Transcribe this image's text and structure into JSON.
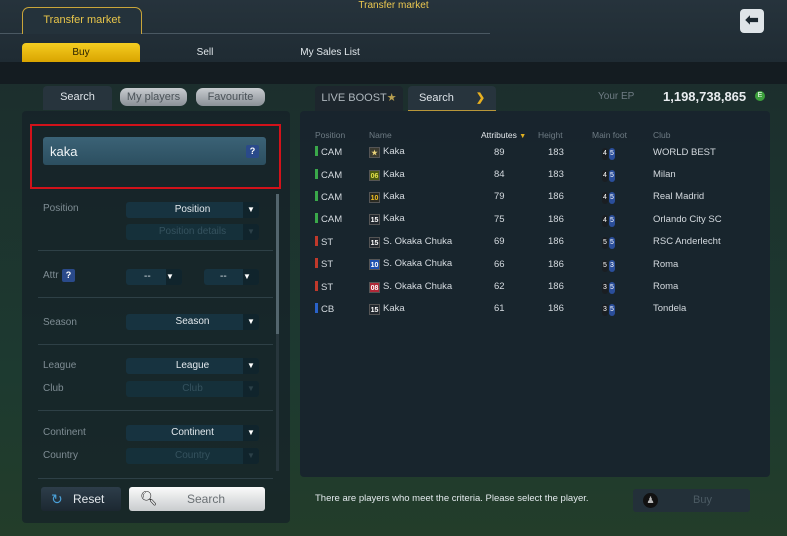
{
  "window_title": "Transfer market",
  "main_tab": "Transfer market",
  "subtabs": [
    "Buy",
    "Sell",
    "My Sales List"
  ],
  "left_tabs": [
    "Search",
    "My players",
    "Favourite"
  ],
  "search": {
    "value": "kaka",
    "help": "?"
  },
  "filters": {
    "position_label": "Position",
    "position": "Position",
    "position_details": "Position details",
    "attr_label": "Attr",
    "attr_help": "?",
    "attr_min": "--",
    "attr_max": "--",
    "season_label": "Season",
    "season": "Season",
    "league_label": "League",
    "league": "League",
    "club_label": "Club",
    "club": "Club",
    "continent_label": "Continent",
    "continent": "Continent",
    "country_label": "Country",
    "country": "Country"
  },
  "reset_label": "Reset",
  "search_label": "Search",
  "right_tabs": [
    "LIVE BOOST",
    "Search"
  ],
  "ep": {
    "label": "Your EP",
    "value": "1,198,738,865",
    "icon_letter": "E"
  },
  "table": {
    "headers": [
      "Position",
      "Name",
      "Attributes",
      "Height",
      "Main foot",
      "Club"
    ],
    "rows": [
      {
        "pos": "CAM",
        "pos_color": "#3aa84a",
        "season": "★",
        "season_bg": "#3a3a30",
        "season_fg": "#e8d27a",
        "name": "Kaka",
        "attr": "89",
        "height": "183",
        "foot": [
          "4",
          "5"
        ],
        "club": "WORLD BEST"
      },
      {
        "pos": "CAM",
        "pos_color": "#3aa84a",
        "season": "06",
        "season_bg": "#4d5a14",
        "season_fg": "#e6e24a",
        "name": "Kaka",
        "attr": "84",
        "height": "183",
        "foot": [
          "4",
          "5"
        ],
        "club": "Milan"
      },
      {
        "pos": "CAM",
        "pos_color": "#3aa84a",
        "season": "10",
        "season_bg": "#2a2a22",
        "season_fg": "#f0c020",
        "name": "Kaka",
        "attr": "79",
        "height": "186",
        "foot": [
          "4",
          "5"
        ],
        "club": "Real Madrid"
      },
      {
        "pos": "CAM",
        "pos_color": "#3aa84a",
        "season": "15",
        "season_bg": "#22282e",
        "season_fg": "#ffffff",
        "name": "Kaka",
        "attr": "75",
        "height": "186",
        "foot": [
          "4",
          "5"
        ],
        "club": "Orlando City SC"
      },
      {
        "pos": "ST",
        "pos_color": "#c0392b",
        "season": "15",
        "season_bg": "#22282e",
        "season_fg": "#ffffff",
        "name": "S. Okaka Chuka",
        "attr": "69",
        "height": "186",
        "foot": [
          "5",
          "5"
        ],
        "club": "RSC Anderlecht"
      },
      {
        "pos": "ST",
        "pos_color": "#c0392b",
        "season": "10",
        "season_bg": "#1d4fb0",
        "season_fg": "#ffffff",
        "name": "S. Okaka Chuka",
        "attr": "66",
        "height": "186",
        "foot": [
          "5",
          "3"
        ],
        "club": "Roma"
      },
      {
        "pos": "ST",
        "pos_color": "#c0392b",
        "season": "08",
        "season_bg": "#b02838",
        "season_fg": "#ffffff",
        "name": "S. Okaka Chuka",
        "attr": "62",
        "height": "186",
        "foot": [
          "3",
          "5"
        ],
        "club": "Roma"
      },
      {
        "pos": "CB",
        "pos_color": "#2a62c8",
        "season": "15",
        "season_bg": "#22282e",
        "season_fg": "#ffffff",
        "name": "Kaka",
        "attr": "61",
        "height": "186",
        "foot": [
          "3",
          "5"
        ],
        "club": "Tondela"
      }
    ]
  },
  "message": "There are players who meet the criteria. Please select the player.",
  "buy_label": "Buy"
}
